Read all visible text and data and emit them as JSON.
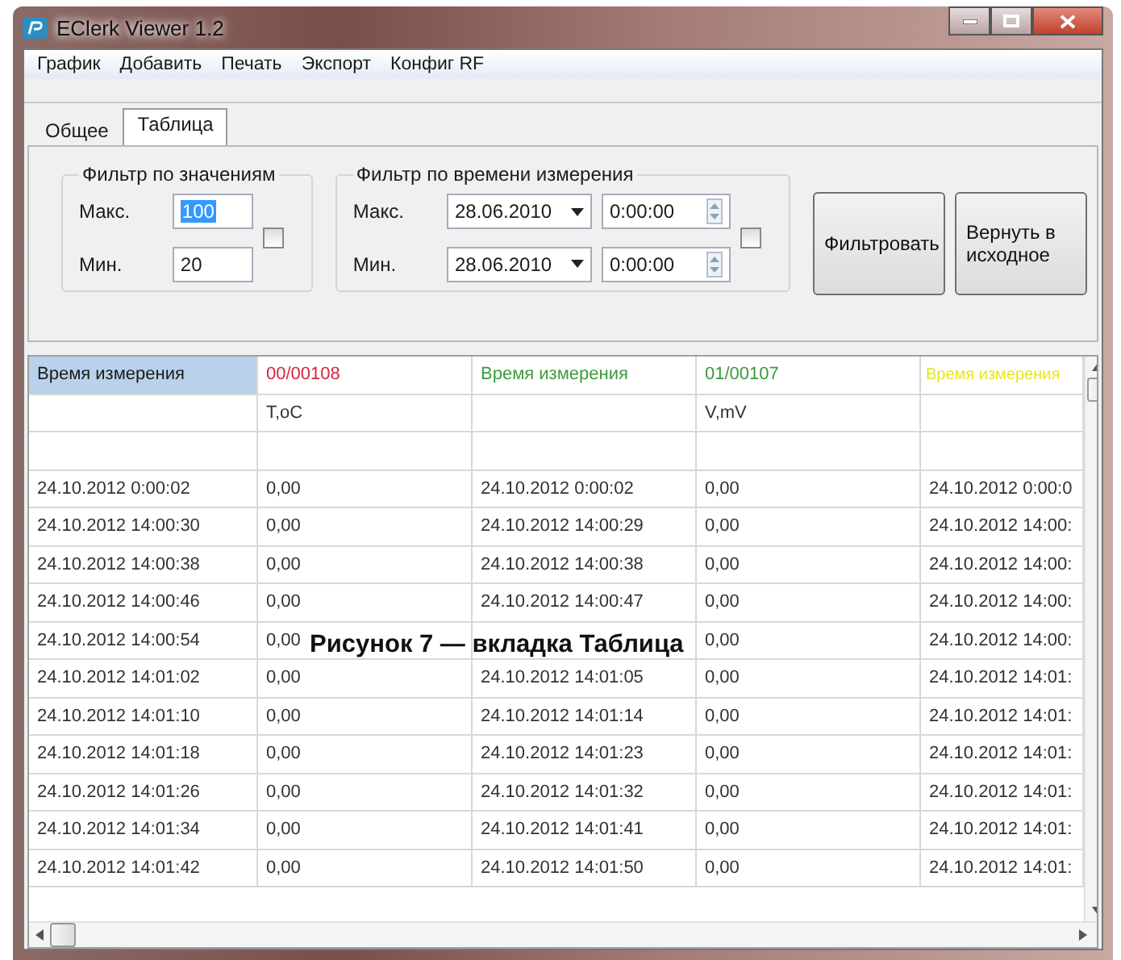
{
  "window": {
    "title": "EClerk Viewer 1.2"
  },
  "menu": [
    "График",
    "Добавить",
    "Печать",
    "Экспорт",
    "Конфиг RF"
  ],
  "tabs": [
    {
      "label": "Общее",
      "selected": false
    },
    {
      "label": "Таблица",
      "selected": true
    }
  ],
  "value_filter": {
    "title": "Фильтр по значениям",
    "max_label": "Макс.",
    "max_value": "100",
    "max_text_selected": true,
    "min_label": "Мин.",
    "min_value": "20",
    "checked": false
  },
  "time_filter": {
    "title": "Фильтр по времени измерения",
    "max_label": "Макс.",
    "max_date": "28.06.2010",
    "max_time": "0:00:00",
    "min_label": "Мин.",
    "min_date": "28.06.2010",
    "min_time": "0:00:00",
    "checked": false
  },
  "buttons": [
    "Фильтровать",
    "Вернуть в исходное"
  ],
  "table": {
    "columns": [
      {
        "label": "Время измерения",
        "color": "#1a1a1a",
        "selected": true
      },
      {
        "label": "00/00108",
        "color": "#d8283c",
        "selected": false,
        "unit": "T,oC"
      },
      {
        "label": "Время измерения",
        "color": "#3f9a3f",
        "selected": false
      },
      {
        "label": "01/00107",
        "color": "#3f9a3f",
        "selected": false,
        "unit": "V,mV"
      },
      {
        "label": "Время измерения",
        "color": "#e6e61e",
        "selected": false
      }
    ],
    "rows": [
      [
        "24.10.2012 0:00:02",
        "0,00",
        "24.10.2012 0:00:02",
        "0,00",
        "24.10.2012 0:00:0"
      ],
      [
        "24.10.2012 14:00:30",
        "0,00",
        "24.10.2012 14:00:29",
        "0,00",
        "24.10.2012 14:00:"
      ],
      [
        "24.10.2012 14:00:38",
        "0,00",
        "24.10.2012 14:00:38",
        "0,00",
        "24.10.2012 14:00:"
      ],
      [
        "24.10.2012 14:00:46",
        "0,00",
        "24.10.2012 14:00:47",
        "0,00",
        "24.10.2012 14:00:"
      ],
      [
        "24.10.2012 14:00:54",
        "0,00",
        null,
        "0,00",
        "24.10.2012 14:00:"
      ],
      [
        "24.10.2012 14:01:02",
        "0,00",
        "24.10.2012 14:01:05",
        "0,00",
        "24.10.2012 14:01:"
      ],
      [
        "24.10.2012 14:01:10",
        "0,00",
        "24.10.2012 14:01:14",
        "0,00",
        "24.10.2012 14:01:"
      ],
      [
        "24.10.2012 14:01:18",
        "0,00",
        "24.10.2012 14:01:23",
        "0,00",
        "24.10.2012 14:01:"
      ],
      [
        "24.10.2012 14:01:26",
        "0,00",
        "24.10.2012 14:01:32",
        "0,00",
        "24.10.2012 14:01:"
      ],
      [
        "24.10.2012 14:01:34",
        "0,00",
        "24.10.2012 14:01:41",
        "0,00",
        "24.10.2012 14:01:"
      ],
      [
        "24.10.2012 14:01:42",
        "0,00",
        "24.10.2012 14:01:50",
        "0,00",
        "24.10.2012 14:01:"
      ]
    ]
  },
  "caption": "Рисунок 7 — вкладка Таблица"
}
